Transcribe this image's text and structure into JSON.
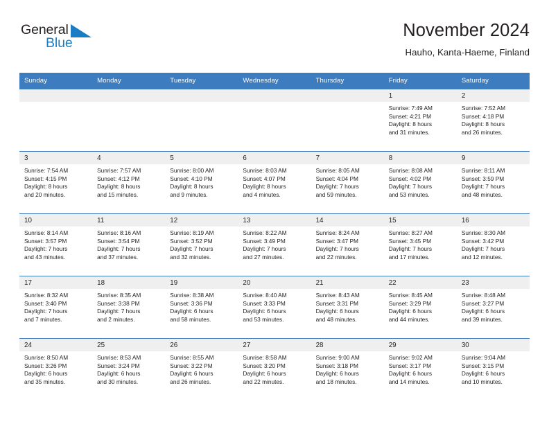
{
  "brand": {
    "name_part1": "General",
    "name_part2": "Blue",
    "triangle_icon": "triangle-icon",
    "accent_color": "#1a7dc4",
    "dark_color": "#231f20"
  },
  "header": {
    "title": "November 2024",
    "subtitle": "Hauho, Kanta-Haeme, Finland"
  },
  "theme": {
    "header_bg": "#3c7cbf",
    "header_text": "#ffffff",
    "daynum_bg": "#efefef",
    "row_border": "#3c7cbf"
  },
  "weekday_headers": [
    "Sunday",
    "Monday",
    "Tuesday",
    "Wednesday",
    "Thursday",
    "Friday",
    "Saturday"
  ],
  "weeks": [
    [
      {
        "day": "",
        "sunrise": "",
        "sunset": "",
        "daylight": "",
        "daylight2": ""
      },
      {
        "day": "",
        "sunrise": "",
        "sunset": "",
        "daylight": "",
        "daylight2": ""
      },
      {
        "day": "",
        "sunrise": "",
        "sunset": "",
        "daylight": "",
        "daylight2": ""
      },
      {
        "day": "",
        "sunrise": "",
        "sunset": "",
        "daylight": "",
        "daylight2": ""
      },
      {
        "day": "",
        "sunrise": "",
        "sunset": "",
        "daylight": "",
        "daylight2": ""
      },
      {
        "day": "1",
        "sunrise": "Sunrise: 7:49 AM",
        "sunset": "Sunset: 4:21 PM",
        "daylight": "Daylight: 8 hours",
        "daylight2": "and 31 minutes."
      },
      {
        "day": "2",
        "sunrise": "Sunrise: 7:52 AM",
        "sunset": "Sunset: 4:18 PM",
        "daylight": "Daylight: 8 hours",
        "daylight2": "and 26 minutes."
      }
    ],
    [
      {
        "day": "3",
        "sunrise": "Sunrise: 7:54 AM",
        "sunset": "Sunset: 4:15 PM",
        "daylight": "Daylight: 8 hours",
        "daylight2": "and 20 minutes."
      },
      {
        "day": "4",
        "sunrise": "Sunrise: 7:57 AM",
        "sunset": "Sunset: 4:12 PM",
        "daylight": "Daylight: 8 hours",
        "daylight2": "and 15 minutes."
      },
      {
        "day": "5",
        "sunrise": "Sunrise: 8:00 AM",
        "sunset": "Sunset: 4:10 PM",
        "daylight": "Daylight: 8 hours",
        "daylight2": "and 9 minutes."
      },
      {
        "day": "6",
        "sunrise": "Sunrise: 8:03 AM",
        "sunset": "Sunset: 4:07 PM",
        "daylight": "Daylight: 8 hours",
        "daylight2": "and 4 minutes."
      },
      {
        "day": "7",
        "sunrise": "Sunrise: 8:05 AM",
        "sunset": "Sunset: 4:04 PM",
        "daylight": "Daylight: 7 hours",
        "daylight2": "and 59 minutes."
      },
      {
        "day": "8",
        "sunrise": "Sunrise: 8:08 AM",
        "sunset": "Sunset: 4:02 PM",
        "daylight": "Daylight: 7 hours",
        "daylight2": "and 53 minutes."
      },
      {
        "day": "9",
        "sunrise": "Sunrise: 8:11 AM",
        "sunset": "Sunset: 3:59 PM",
        "daylight": "Daylight: 7 hours",
        "daylight2": "and 48 minutes."
      }
    ],
    [
      {
        "day": "10",
        "sunrise": "Sunrise: 8:14 AM",
        "sunset": "Sunset: 3:57 PM",
        "daylight": "Daylight: 7 hours",
        "daylight2": "and 43 minutes."
      },
      {
        "day": "11",
        "sunrise": "Sunrise: 8:16 AM",
        "sunset": "Sunset: 3:54 PM",
        "daylight": "Daylight: 7 hours",
        "daylight2": "and 37 minutes."
      },
      {
        "day": "12",
        "sunrise": "Sunrise: 8:19 AM",
        "sunset": "Sunset: 3:52 PM",
        "daylight": "Daylight: 7 hours",
        "daylight2": "and 32 minutes."
      },
      {
        "day": "13",
        "sunrise": "Sunrise: 8:22 AM",
        "sunset": "Sunset: 3:49 PM",
        "daylight": "Daylight: 7 hours",
        "daylight2": "and 27 minutes."
      },
      {
        "day": "14",
        "sunrise": "Sunrise: 8:24 AM",
        "sunset": "Sunset: 3:47 PM",
        "daylight": "Daylight: 7 hours",
        "daylight2": "and 22 minutes."
      },
      {
        "day": "15",
        "sunrise": "Sunrise: 8:27 AM",
        "sunset": "Sunset: 3:45 PM",
        "daylight": "Daylight: 7 hours",
        "daylight2": "and 17 minutes."
      },
      {
        "day": "16",
        "sunrise": "Sunrise: 8:30 AM",
        "sunset": "Sunset: 3:42 PM",
        "daylight": "Daylight: 7 hours",
        "daylight2": "and 12 minutes."
      }
    ],
    [
      {
        "day": "17",
        "sunrise": "Sunrise: 8:32 AM",
        "sunset": "Sunset: 3:40 PM",
        "daylight": "Daylight: 7 hours",
        "daylight2": "and 7 minutes."
      },
      {
        "day": "18",
        "sunrise": "Sunrise: 8:35 AM",
        "sunset": "Sunset: 3:38 PM",
        "daylight": "Daylight: 7 hours",
        "daylight2": "and 2 minutes."
      },
      {
        "day": "19",
        "sunrise": "Sunrise: 8:38 AM",
        "sunset": "Sunset: 3:36 PM",
        "daylight": "Daylight: 6 hours",
        "daylight2": "and 58 minutes."
      },
      {
        "day": "20",
        "sunrise": "Sunrise: 8:40 AM",
        "sunset": "Sunset: 3:33 PM",
        "daylight": "Daylight: 6 hours",
        "daylight2": "and 53 minutes."
      },
      {
        "day": "21",
        "sunrise": "Sunrise: 8:43 AM",
        "sunset": "Sunset: 3:31 PM",
        "daylight": "Daylight: 6 hours",
        "daylight2": "and 48 minutes."
      },
      {
        "day": "22",
        "sunrise": "Sunrise: 8:45 AM",
        "sunset": "Sunset: 3:29 PM",
        "daylight": "Daylight: 6 hours",
        "daylight2": "and 44 minutes."
      },
      {
        "day": "23",
        "sunrise": "Sunrise: 8:48 AM",
        "sunset": "Sunset: 3:27 PM",
        "daylight": "Daylight: 6 hours",
        "daylight2": "and 39 minutes."
      }
    ],
    [
      {
        "day": "24",
        "sunrise": "Sunrise: 8:50 AM",
        "sunset": "Sunset: 3:26 PM",
        "daylight": "Daylight: 6 hours",
        "daylight2": "and 35 minutes."
      },
      {
        "day": "25",
        "sunrise": "Sunrise: 8:53 AM",
        "sunset": "Sunset: 3:24 PM",
        "daylight": "Daylight: 6 hours",
        "daylight2": "and 30 minutes."
      },
      {
        "day": "26",
        "sunrise": "Sunrise: 8:55 AM",
        "sunset": "Sunset: 3:22 PM",
        "daylight": "Daylight: 6 hours",
        "daylight2": "and 26 minutes."
      },
      {
        "day": "27",
        "sunrise": "Sunrise: 8:58 AM",
        "sunset": "Sunset: 3:20 PM",
        "daylight": "Daylight: 6 hours",
        "daylight2": "and 22 minutes."
      },
      {
        "day": "28",
        "sunrise": "Sunrise: 9:00 AM",
        "sunset": "Sunset: 3:18 PM",
        "daylight": "Daylight: 6 hours",
        "daylight2": "and 18 minutes."
      },
      {
        "day": "29",
        "sunrise": "Sunrise: 9:02 AM",
        "sunset": "Sunset: 3:17 PM",
        "daylight": "Daylight: 6 hours",
        "daylight2": "and 14 minutes."
      },
      {
        "day": "30",
        "sunrise": "Sunrise: 9:04 AM",
        "sunset": "Sunset: 3:15 PM",
        "daylight": "Daylight: 6 hours",
        "daylight2": "and 10 minutes."
      }
    ]
  ]
}
